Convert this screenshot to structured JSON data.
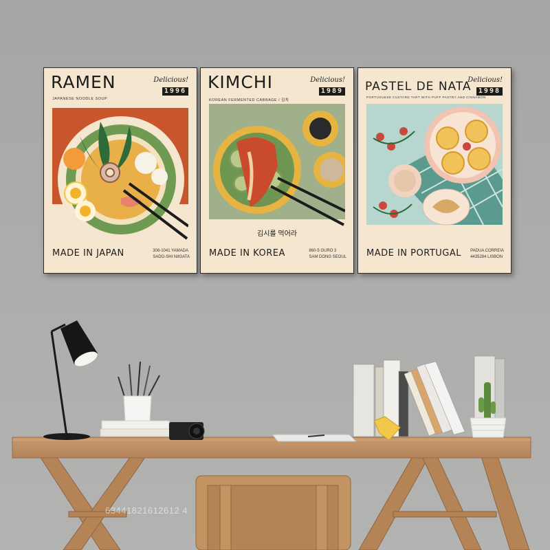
{
  "posters": [
    {
      "title": "RAMEN",
      "delicious": "Delicious!",
      "year": "1996",
      "subtitle": "JAPANESE NOODLE SOUP",
      "made_in": "MADE IN JAPAN",
      "address_line1": "308-1041 YAMADA",
      "address_line2": "SADO-SHI NIIGATA"
    },
    {
      "title": "KIMCHI",
      "delicious": "Delicious!",
      "year": "1989",
      "subtitle": "KOREAN FERMENTED CABBAGE / 김치",
      "korean_text": "김시를 먹어라",
      "made_in": "MADE IN KOREA",
      "address_line1": "860-5 GURO 3",
      "address_line2": "SAM DONG SEOUL"
    },
    {
      "title": "PASTEL DE NATA",
      "delicious": "Delicious!",
      "year": "1998",
      "subtitle": "PORTUGUESE CUSTARD TART WITH PUFF PASTRY AND CINNAMON",
      "made_in": "MADE IN PORTUGAL",
      "address_line1": "PADUA CORREIA",
      "address_line2": "4435284 LISBON"
    }
  ],
  "watermark": "63441821612612 4"
}
